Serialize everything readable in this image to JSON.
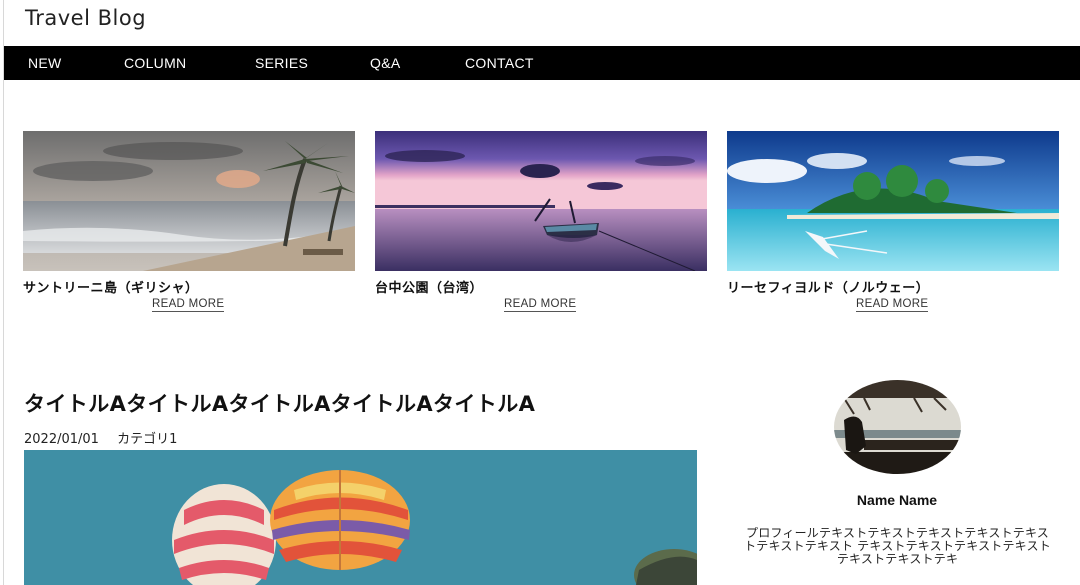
{
  "header": {
    "title": "Travel Blog"
  },
  "nav": {
    "items": [
      "NEW",
      "COLUMN",
      "SERIES",
      "Q&A",
      "CONTACT"
    ]
  },
  "cards": [
    {
      "title": "サントリーニ島（ギリシャ）",
      "link": "READ MORE"
    },
    {
      "title": "台中公園（台湾）",
      "link": "READ MORE"
    },
    {
      "title": "リーセフィヨルド（ノルウェー）",
      "link": "READ MORE"
    }
  ],
  "post": {
    "title": "タイトルAタイトルAタイトルAタイトルAタイトルA",
    "date": "2022/01/01",
    "category": "カテゴリ1"
  },
  "profile": {
    "name": "Name Name",
    "text": "プロフィールテキストテキストテキストテキストテキストテキストテキスト テキストテキストテキストテキストテキストテキストテキ"
  }
}
